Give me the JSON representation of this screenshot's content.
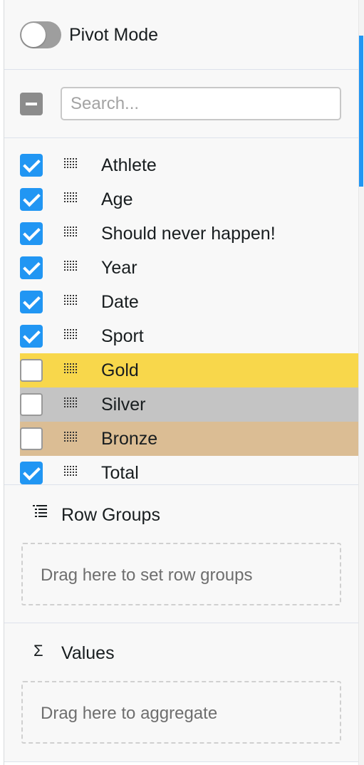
{
  "pivot": {
    "label": "Pivot Mode",
    "enabled": false
  },
  "search": {
    "placeholder": "Search...",
    "value": ""
  },
  "select_all": {
    "state": "indeterminate"
  },
  "columns": [
    {
      "label": "Athlete",
      "checked": true,
      "highlight": null
    },
    {
      "label": "Age",
      "checked": true,
      "highlight": null
    },
    {
      "label": "Should never happen!",
      "checked": true,
      "highlight": null
    },
    {
      "label": "Year",
      "checked": true,
      "highlight": null
    },
    {
      "label": "Date",
      "checked": true,
      "highlight": null
    },
    {
      "label": "Sport",
      "checked": true,
      "highlight": null
    },
    {
      "label": "Gold",
      "checked": false,
      "highlight": "#f8d74b"
    },
    {
      "label": "Silver",
      "checked": false,
      "highlight": "#c4c4c4"
    },
    {
      "label": "Bronze",
      "checked": false,
      "highlight": "#dbbd94"
    },
    {
      "label": "Total",
      "checked": true,
      "highlight": null
    }
  ],
  "row_groups": {
    "title": "Row Groups",
    "drop_text": "Drag here to set row groups",
    "icon": "row-groups-icon"
  },
  "values": {
    "title": "Values",
    "drop_text": "Drag here to aggregate",
    "icon": "sigma-icon"
  },
  "colors": {
    "accent": "#2196f3",
    "toggle_off": "#9e9e9e",
    "panel_bg": "#f8f8f8"
  }
}
